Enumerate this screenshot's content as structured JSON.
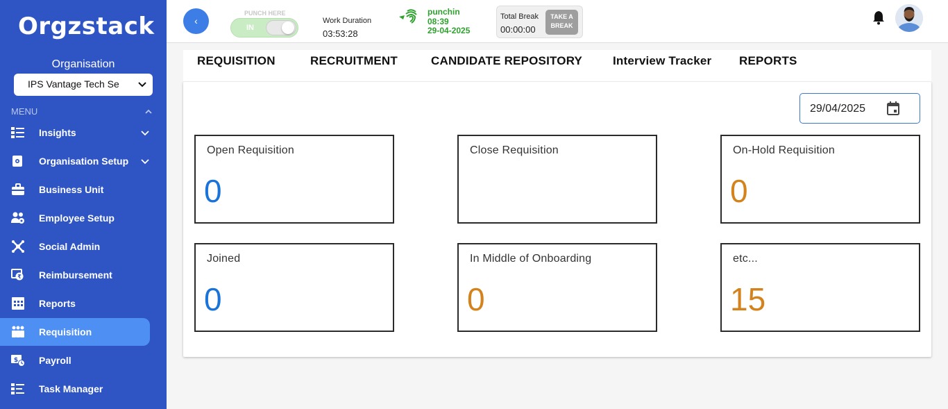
{
  "brand": {
    "logo_text": "Orgzstack"
  },
  "sidebar": {
    "org_label": "Organisation",
    "org_selected": "IPS Vantage Tech Se",
    "menu_label": "MENU",
    "items": [
      {
        "label": "Insights",
        "icon": "list-icon",
        "has_chevron": true
      },
      {
        "label": "Organisation Setup",
        "icon": "org-setup-icon",
        "has_chevron": true
      },
      {
        "label": "Business Unit",
        "icon": "briefcase-icon",
        "has_chevron": false
      },
      {
        "label": "Employee Setup",
        "icon": "employee-setup-icon",
        "has_chevron": false
      },
      {
        "label": "Social Admin",
        "icon": "social-icon",
        "has_chevron": false
      },
      {
        "label": "Reimbursement",
        "icon": "reimbursement-icon",
        "has_chevron": false
      },
      {
        "label": "Reports",
        "icon": "grid-icon",
        "has_chevron": false
      },
      {
        "label": "Requisition",
        "icon": "people-icon",
        "has_chevron": false,
        "active": true
      },
      {
        "label": "Payroll",
        "icon": "payroll-icon",
        "has_chevron": false
      },
      {
        "label": "Task Manager",
        "icon": "task-icon",
        "has_chevron": false
      }
    ]
  },
  "topbar": {
    "back_label": "‹",
    "punch_label": "PUNCH HERE",
    "punch_state": "IN",
    "work_duration_label": "Work Duration",
    "work_duration_value": "03:53:28",
    "punch_status": "punchin",
    "punch_time": "08:39",
    "punch_date": "29-04-2025",
    "total_break_label": "Total Break",
    "total_break_value": "00:00:00",
    "take_break_line1": "TAKE A",
    "take_break_line2": "BREAK"
  },
  "tabs": [
    "REQUISITION",
    "RECRUITMENT",
    "CANDIDATE REPOSITORY",
    "Interview Tracker",
    "REPORTS"
  ],
  "filter": {
    "date": "29/04/2025"
  },
  "cards": [
    {
      "title": "Open Requisition",
      "value": "0",
      "color": "#1a73d9"
    },
    {
      "title": "Close Requisition",
      "value": "",
      "color": "#1a73d9"
    },
    {
      "title": "On-Hold Requisition",
      "value": "0",
      "color": "#d4821c"
    },
    {
      "title": "Joined",
      "value": "0",
      "color": "#1a73d9"
    },
    {
      "title": "In Middle of Onboarding",
      "value": "0",
      "color": "#d4821c"
    },
    {
      "title": "etc...",
      "value": "15",
      "color": "#d4821c"
    }
  ],
  "colors": {
    "sidebar": "#2f55c4",
    "active_nav": "#4d8ff2",
    "punch_green": "#2ea12e"
  }
}
